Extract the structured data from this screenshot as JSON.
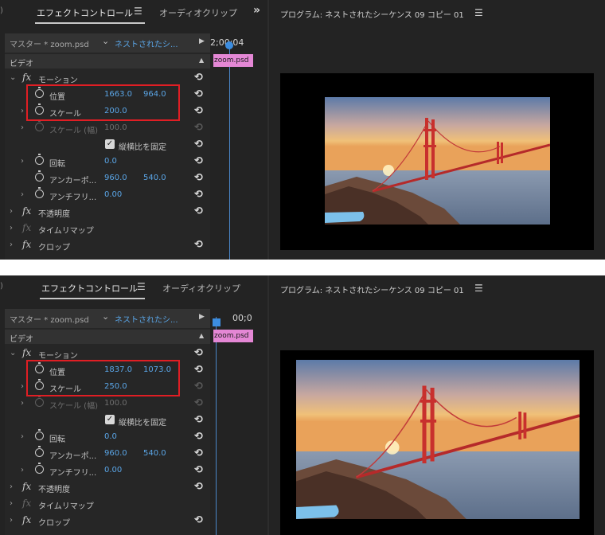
{
  "panels": [
    {
      "tabs": {
        "effect_controls": "エフェクトコントロール",
        "audio_clip": "オーディオクリップミ"
      },
      "source": {
        "master": "マスター * zoom.psd",
        "sequence": "ネストされたシ..."
      },
      "video_header": "ビデオ",
      "timeline": {
        "timecode": "2;00;04",
        "clip": "zoom.psd"
      },
      "motion": {
        "label": "モーション",
        "position_label": "位置",
        "position_x": "1663.0",
        "position_y": "964.0",
        "scale_label": "スケール",
        "scale_value": "200.0",
        "scale_width_label": "スケール (幅)",
        "scale_width_value": "100.0",
        "uniform_scale_label": "縦横比を固定",
        "rotation_label": "回転",
        "rotation_value": "0.0",
        "anchor_label": "アンカーポ...",
        "anchor_x": "960.0",
        "anchor_y": "540.0",
        "antiflicker_label": "アンチフリ...",
        "antiflicker_value": "0.00"
      },
      "opacity_label": "不透明度",
      "time_remap_label": "タイムリマップ",
      "crop_label": "クロップ",
      "program_title": "プログラム: ネストされたシーケンス 09 コピー 01"
    },
    {
      "tabs": {
        "effect_controls": "エフェクトコントロール",
        "audio_clip": "オーディオクリップ"
      },
      "source": {
        "master": "マスター * zoom.psd",
        "sequence": "ネストされたシ..."
      },
      "video_header": "ビデオ",
      "timeline": {
        "timecode": "00;0",
        "clip": "zoom.psd"
      },
      "motion": {
        "label": "モーション",
        "position_label": "位置",
        "position_x": "1837.0",
        "position_y": "1073.0",
        "scale_label": "スケール",
        "scale_value": "250.0",
        "scale_width_label": "スケール (幅)",
        "scale_width_value": "100.0",
        "uniform_scale_label": "縦横比を固定",
        "rotation_label": "回転",
        "rotation_value": "0.0",
        "anchor_label": "アンカーポ...",
        "anchor_x": "960.0",
        "anchor_y": "540.0",
        "antiflicker_label": "アンチフリ...",
        "antiflicker_value": "0.00"
      },
      "opacity_label": "不透明度",
      "time_remap_label": "タイムリマップ",
      "crop_label": "クロップ",
      "program_title": "プログラム: ネストされたシーケンス 09 コピー 01"
    }
  ],
  "colors": {
    "value_blue": "#5aa5e6",
    "highlight_red": "#e01e24",
    "clip_pink": "#e487d5",
    "panel_bg": "#232323"
  },
  "icons": [
    "hamburger-menu-icon",
    "panel-overflow-icon",
    "chevron-down-icon",
    "play-icon",
    "collapse-up-icon",
    "twirl-icon",
    "fx-icon",
    "stopwatch-icon",
    "reset-icon",
    "checkbox-icon"
  ]
}
